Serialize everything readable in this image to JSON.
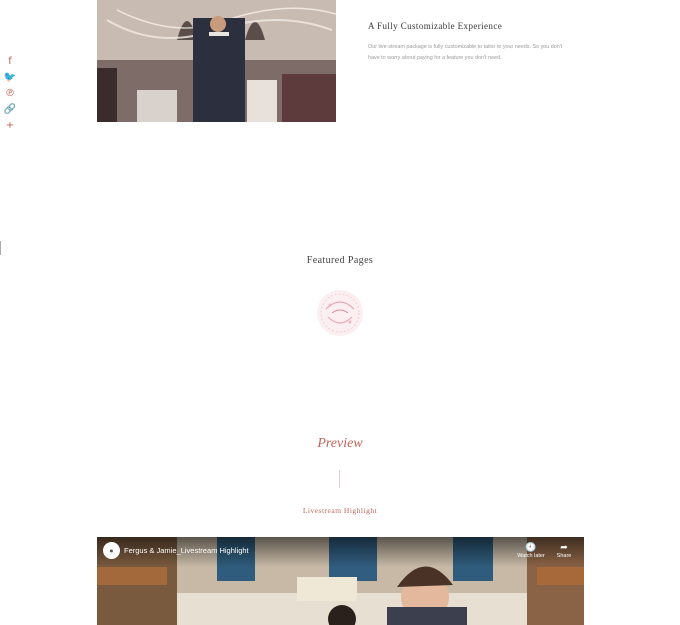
{
  "share": {
    "items": [
      {
        "icon": "facebook-icon",
        "glyph": "f"
      },
      {
        "icon": "twitter-icon",
        "glyph": "🐦"
      },
      {
        "icon": "pinterest-icon",
        "glyph": "℗"
      },
      {
        "icon": "link-icon",
        "glyph": "🔗"
      },
      {
        "icon": "plus-icon",
        "glyph": "+"
      }
    ],
    "color": "#c0655c"
  },
  "feature": {
    "title": "A Fully Customizable Experience",
    "text": "Our live-stream package is fully customizable to tailor to your needs. So you don't have to worry about paying for a feature you don't need."
  },
  "featured": {
    "heading": "Featured Pages"
  },
  "preview": {
    "heading": "Preview",
    "subheading": "Livestream Highlight"
  },
  "video": {
    "title": "Fergus & Jamie_Livestream Highlight",
    "watch_later_label": "Watch later",
    "share_label": "Share",
    "watch_later_icon": "clock-icon",
    "share_icon": "share-arrow-icon"
  }
}
